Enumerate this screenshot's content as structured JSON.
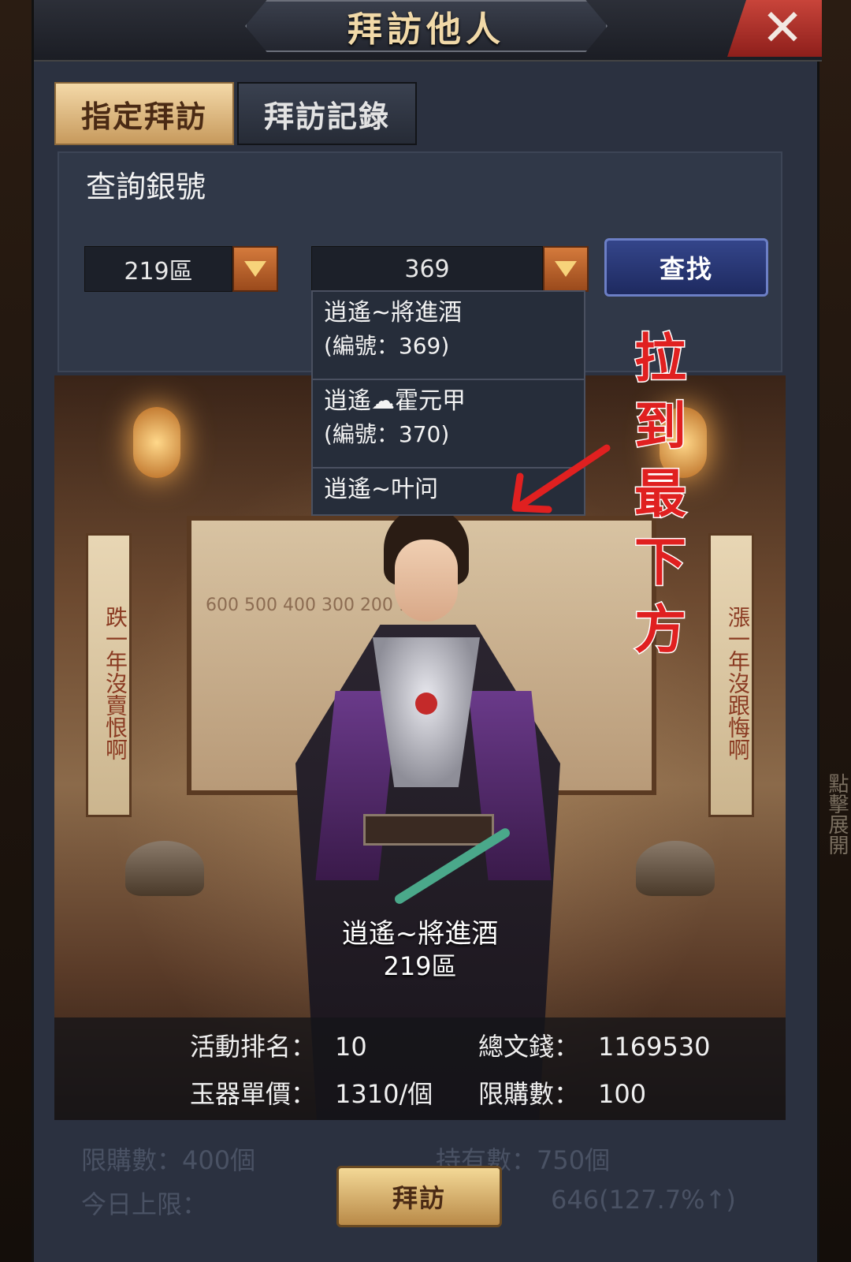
{
  "title": "拜訪他人",
  "close_icon": "close-icon",
  "tabs": [
    {
      "label": "指定拜訪",
      "active": true
    },
    {
      "label": "拜訪記錄",
      "active": false
    }
  ],
  "search": {
    "title": "查詢銀號",
    "zone_value": "219區",
    "id_value": "369",
    "find_label": "查找"
  },
  "dropdown_items": [
    {
      "name": "逍遙~將進酒",
      "id_line": "(編號：369)"
    },
    {
      "name": "逍遙☁霍元甲",
      "id_line": "(編號：370)"
    },
    {
      "name": "逍遙~叶问",
      "id_line": ""
    }
  ],
  "annotation": "拉到最下方",
  "scene": {
    "scroll_left": "跌一年沒賣恨啊",
    "scroll_right": "漲一年沒跟悔啊",
    "board_numbers": "600 500 400 300 200 100"
  },
  "character": {
    "name": "逍遙~將進酒",
    "zone": "219區"
  },
  "stats": {
    "rank_label": "活動排名：",
    "rank_value": "10",
    "coins_label": "總文錢：",
    "coins_value": "1169530",
    "price_label": "玉器單價：",
    "price_value": "1310/個",
    "limit_label": "限購數：",
    "limit_value": "100"
  },
  "footer_faint": {
    "f1": "限購數：400個",
    "f2": "持有數：750個",
    "f3": "今日上限：",
    "f4": "646(127.7%↑)"
  },
  "side_hint": "點擊展開",
  "visit_label": "拜訪",
  "colors": {
    "annotation_red": "#e02020",
    "tab_active": "#f4d9a8",
    "find_button": "#34458a",
    "visit_button": "#f3d896"
  }
}
